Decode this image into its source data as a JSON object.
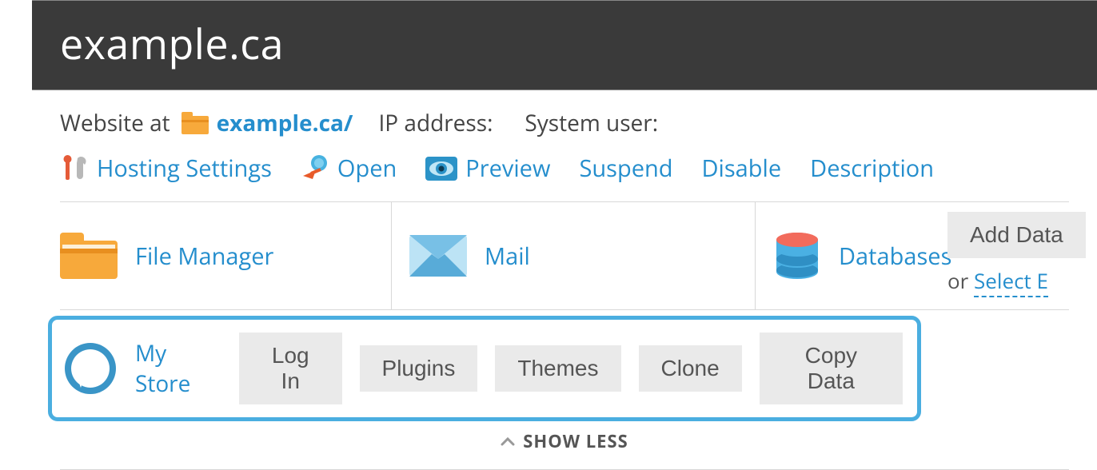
{
  "header": {
    "title": "example.ca"
  },
  "info": {
    "website_label": "Website at",
    "website_link": "example.ca/",
    "ip_label": "IP address:",
    "user_label": "System user:"
  },
  "actions": {
    "hosting": "Hosting Settings",
    "open": "Open",
    "preview": "Preview",
    "suspend": "Suspend",
    "disable": "Disable",
    "description": "Description"
  },
  "tiles": {
    "file_manager": "File Manager",
    "mail": "Mail",
    "databases": "Databases",
    "add_database": "Add Data",
    "or": "or",
    "select_existing": "Select E"
  },
  "wp": {
    "name": "My Store",
    "buttons": {
      "login": "Log In",
      "plugins": "Plugins",
      "themes": "Themes",
      "clone": "Clone",
      "copy_data": "Copy Data"
    }
  },
  "footer": {
    "show_less": "SHOW LESS"
  }
}
